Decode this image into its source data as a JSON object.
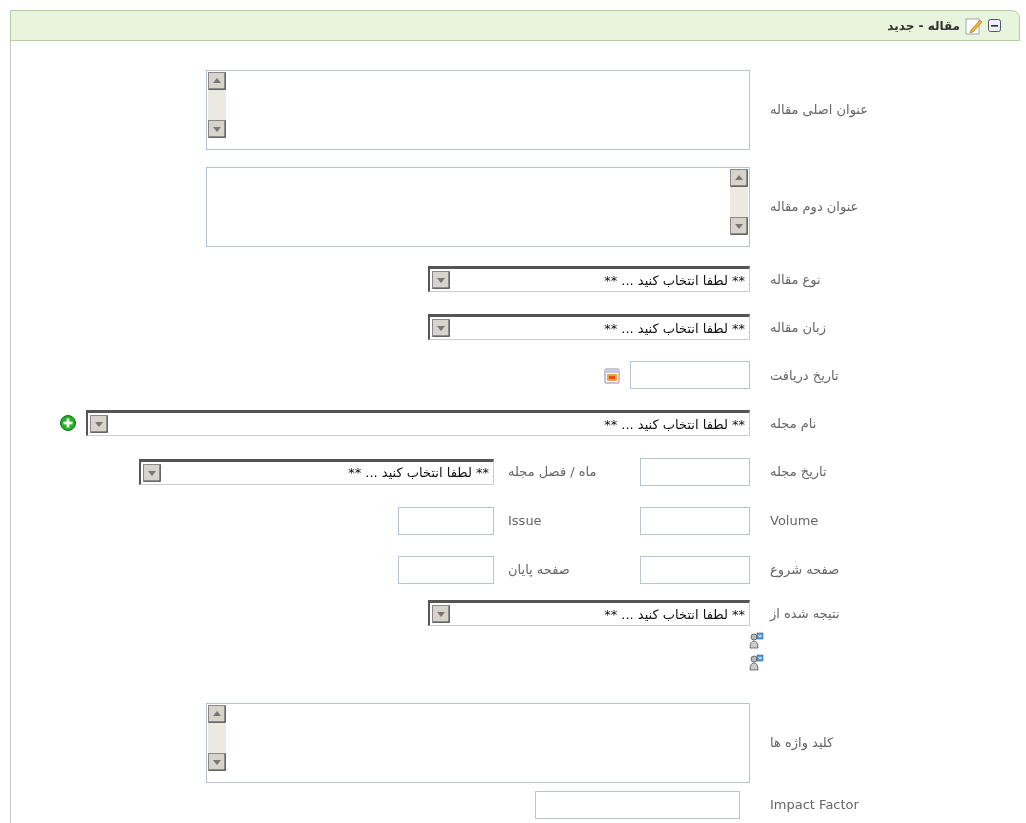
{
  "panel": {
    "title": "مقاله - جدید",
    "expanded": true
  },
  "fields": [
    {
      "kind": "textarea",
      "label": "عنوان اصلی مقاله"
    },
    {
      "kind": "memo",
      "label": "عنوان دوم مقاله"
    },
    {
      "kind": "select",
      "label": "نوع مقاله",
      "value": "** لطفا انتخاب کنید ... **"
    },
    {
      "kind": "select",
      "label": "زبان مقاله",
      "value": "** لطفا انتخاب کنید ... **"
    },
    {
      "kind": "date",
      "label": "تاریخ دریافت"
    },
    {
      "kind": "select-add",
      "label": "نام مجله",
      "value": "** لطفا انتخاب کنید ... **"
    },
    {
      "kind": "pair",
      "items": [
        {
          "kind": "input",
          "label": "تاریخ مجله"
        },
        {
          "kind": "select",
          "label": "ماه / فصل مجله",
          "value": "** لطفا انتخاب کنید ... **"
        }
      ]
    },
    {
      "kind": "pair",
      "items": [
        {
          "kind": "input",
          "label": "Volume"
        },
        {
          "kind": "input",
          "label": "Issue"
        }
      ]
    },
    {
      "kind": "pair",
      "items": [
        {
          "kind": "input",
          "label": "صفحه شروع"
        },
        {
          "kind": "input",
          "label": "صفحه پایان"
        }
      ]
    },
    {
      "kind": "select-linked",
      "label": "نتیجه شده از",
      "value": "** لطفا انتخاب کنید ... **"
    },
    {
      "kind": "textarea",
      "label": "کلید واژه ها"
    },
    {
      "kind": "input",
      "label": "Impact Factor"
    }
  ]
}
